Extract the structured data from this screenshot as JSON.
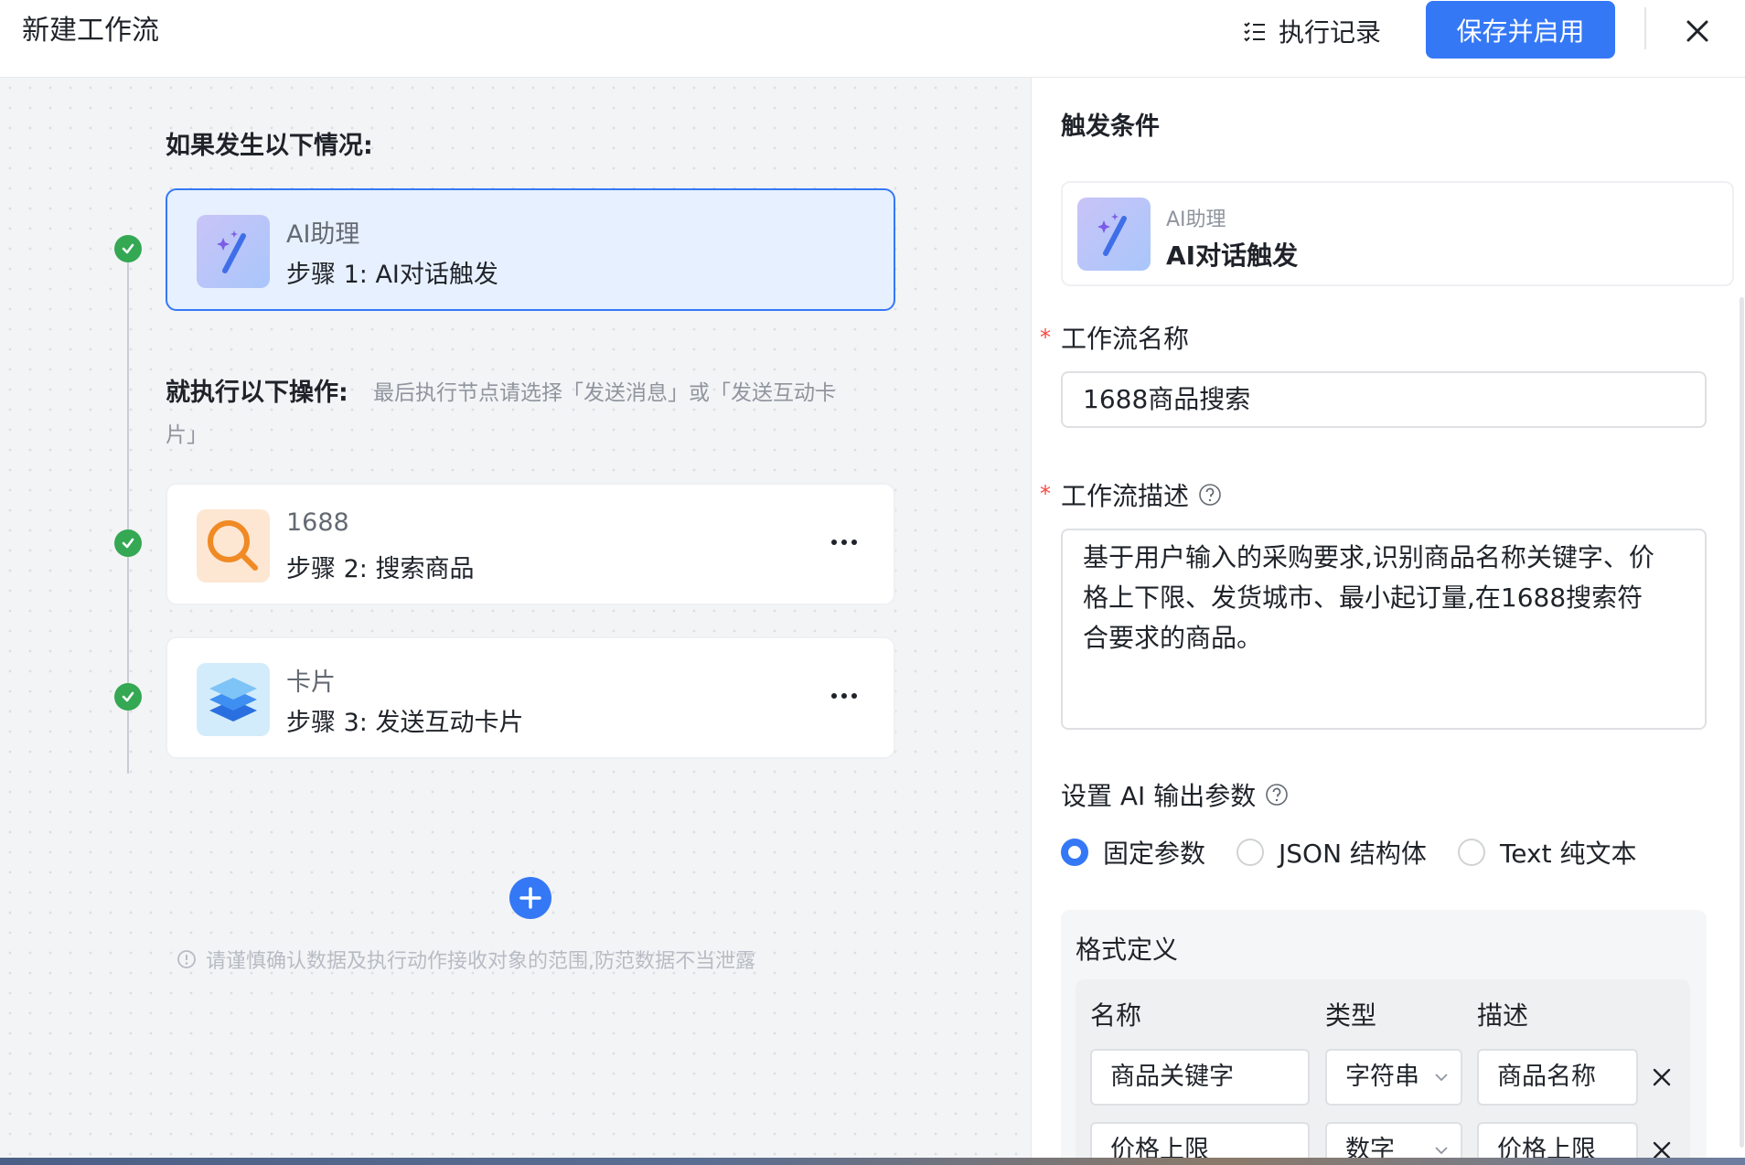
{
  "header": {
    "title": "新建工作流",
    "exec_record_label": "执行记录",
    "save_label": "保存并启用"
  },
  "canvas": {
    "if_label": "如果发生以下情况:",
    "then_label": "就执行以下操作:",
    "then_hint_line1": "最后执行节点请选择「发送消息」或「发送互动卡",
    "then_hint_line2": "片」",
    "nodes": [
      {
        "app": "AI助理",
        "step": "步骤 1:  AI对话触发"
      },
      {
        "app": "1688",
        "step": "步骤 2:  搜索商品"
      },
      {
        "app": "卡片",
        "step": "步骤 3:  发送互动卡片"
      }
    ],
    "warning_note": "请谨慎确认数据及执行动作接收对象的范围,防范数据不当泄露"
  },
  "panel": {
    "title": "触发条件",
    "trigger": {
      "app": "AI助理",
      "name": "AI对话触发"
    },
    "name_field": {
      "label": "工作流名称",
      "value": "1688商品搜索"
    },
    "desc_field": {
      "label": "工作流描述",
      "value_line1": "基于用户输入的采购要求,识别商品名称关键字、价",
      "value_line2": "格上下限、发货城市、最小起订量,在1688搜索符",
      "value_line3": "合要求的商品。"
    },
    "output_params": {
      "label": "设置 AI 输出参数",
      "options": [
        "固定参数",
        "JSON 结构体",
        "Text 纯文本"
      ],
      "selected": "固定参数"
    },
    "format": {
      "title": "格式定义",
      "columns": [
        "名称",
        "类型",
        "描述"
      ],
      "rows": [
        {
          "name": "商品关键字",
          "type": "字符串",
          "desc": "商品名称"
        },
        {
          "name": "价格上限",
          "type": "数字",
          "desc": "价格上限"
        }
      ]
    }
  },
  "colors": {
    "accent": "#3478f6",
    "success": "#34a853",
    "required": "#f54a45"
  }
}
